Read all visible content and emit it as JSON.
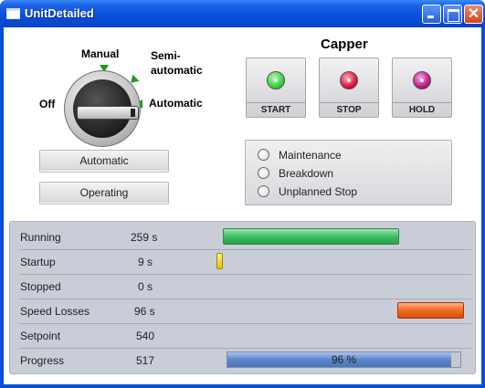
{
  "window": {
    "title": "UnitDetailed"
  },
  "selector": {
    "positions": {
      "off": "Off",
      "manual": "Manual",
      "semi_line1": "Semi-",
      "semi_line2": "automatic",
      "automatic": "Automatic"
    },
    "selected": "Automatic"
  },
  "mode_buttons": {
    "mode": "Automatic",
    "state": "Operating"
  },
  "capper": {
    "title": "Capper",
    "buttons": [
      {
        "label": "START",
        "led_color": "#3cd23c"
      },
      {
        "label": "STOP",
        "led_color": "#e0143c"
      },
      {
        "label": "HOLD",
        "led_color": "#c01888"
      }
    ]
  },
  "reasons": [
    {
      "label": "Maintenance",
      "checked": false
    },
    {
      "label": "Breakdown",
      "checked": false
    },
    {
      "label": "Unplanned Stop",
      "checked": false
    }
  ],
  "stats": [
    {
      "name": "Running",
      "value": "259 s",
      "bar_color": "#3cc063"
    },
    {
      "name": "Startup",
      "value": "9 s",
      "bar_color": "#e8c400"
    },
    {
      "name": "Stopped",
      "value": "0 s"
    },
    {
      "name": "Speed Losses",
      "value": "96 s",
      "bar_color": "#f06a20"
    },
    {
      "name": "Setpoint",
      "value": "540"
    },
    {
      "name": "Progress",
      "value": "517",
      "progress_fraction": 0.96,
      "progress_text": "96 %"
    }
  ],
  "colors": {
    "titlebar": "#0a50dc",
    "stats_panel": "#c9cdd8",
    "progress": "#5a86cc"
  }
}
